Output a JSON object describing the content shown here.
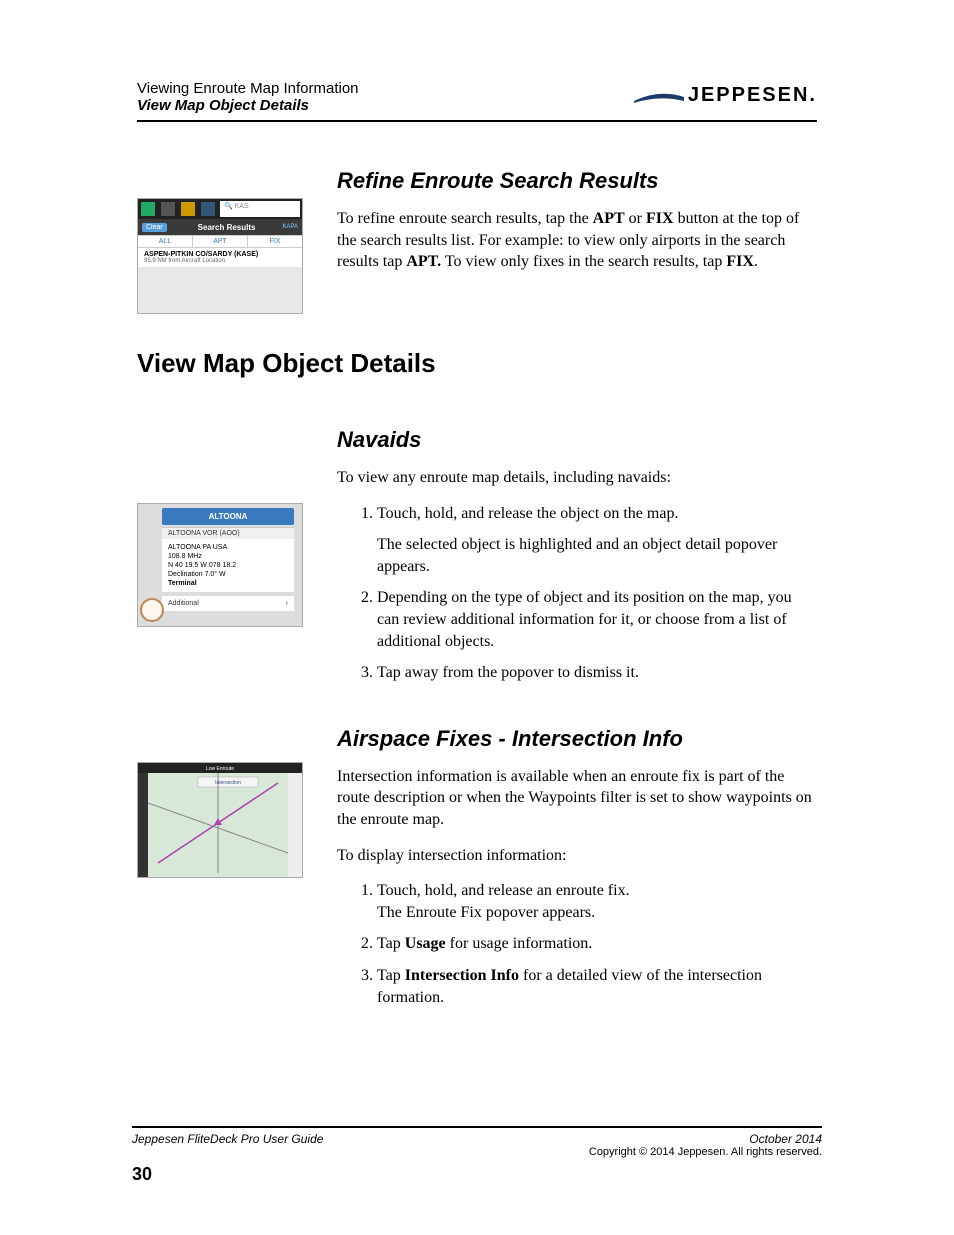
{
  "header": {
    "line1": "Viewing Enroute Map Information",
    "line2": "View Map Object Details",
    "logo_text": "JEPPESEN."
  },
  "section_refine": {
    "title": "Refine Enroute Search Results",
    "para_parts": {
      "p1a": "To refine enroute search results, tap the ",
      "p1b": "APT",
      "p1c": " or ",
      "p1d": "FIX",
      "p1e": " button at the top of the search results list. For example: to view only airports in the search results tap ",
      "p1f": "APT.",
      "p1g": " To view only fixes in the search results, tap ",
      "p1h": "FIX",
      "p1i": "."
    },
    "fig": {
      "search_value": "KAS",
      "clear": "Clear",
      "sr_title": "Search Results",
      "tabs": [
        "ALL",
        "APT",
        "FIX"
      ],
      "result_main": "ASPEN-PITKIN CO/SARDY (KASE)",
      "result_sub": "95.9 NM from Aircraft Location",
      "right_label": "KAPA"
    }
  },
  "chapter_title": "View Map Object Details",
  "section_navaids": {
    "title": "Navaids",
    "intro": "To view any enroute map details, including navaids:",
    "steps": {
      "s1": "Touch, hold, and release the object on the map.",
      "s1b": "The selected object is highlighted and an object detail popover appears.",
      "s2": "Depending on the type of object and its position on the map, you can review additional information for it, or choose from a list of additional objects.",
      "s3": "Tap away from the popover to dismiss it."
    },
    "fig": {
      "title": "ALTOONA",
      "sub": "ALTOONA VOR (AOO)",
      "l1": "ALTOONA PA USA",
      "l2": "108.8 MHz",
      "l3": "N 40 19.5   W 078 18.2",
      "l4": "Declination 7.0° W",
      "l5": "Terminal",
      "additional": "Additional",
      "chevron": "›"
    }
  },
  "section_fixes": {
    "title": "Airspace Fixes - Intersection Info",
    "p1": "Intersection information is available when an enroute fix is part of the route description or when the Waypoints filter is set to show waypoints on the enroute map.",
    "p2": "To display intersection information:",
    "steps": {
      "s1a": "Touch, hold, and release an enroute fix.",
      "s1b": "The Enroute Fix popover appears.",
      "s2a": "Tap ",
      "s2b": "Usage",
      "s2c": " for usage information.",
      "s3a": "Tap ",
      "s3b": "Intersection Info",
      "s3c": " for a detailed view of the intersection formation."
    },
    "fig": {
      "top": "Low Enroute",
      "tab": "Intersection"
    }
  },
  "footer": {
    "guide": "Jeppesen FliteDeck Pro User Guide",
    "date": "October 2014",
    "copyright": "Copyright © 2014 Jeppesen. All rights reserved.",
    "page": "30"
  }
}
